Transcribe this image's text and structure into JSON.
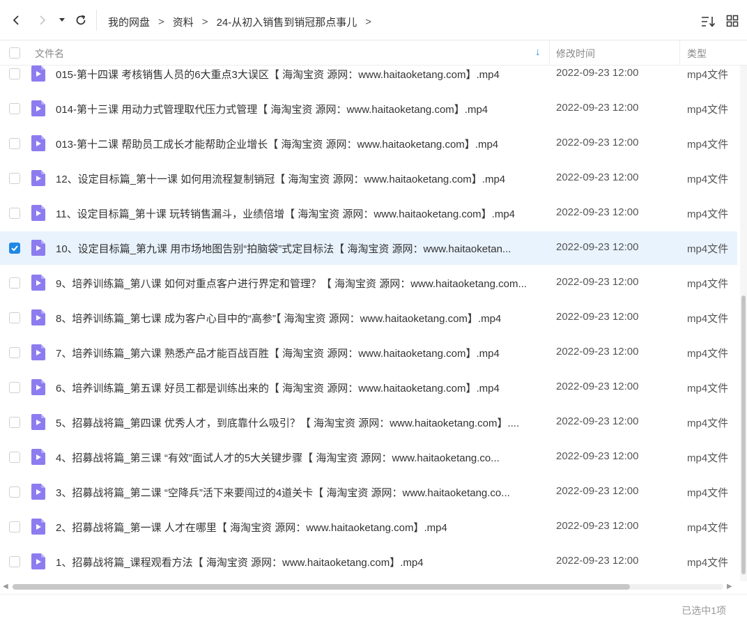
{
  "toolbar": {
    "back_icon": "chevron-left-icon",
    "forward_icon": "chevron-right-icon",
    "history_icon": "caret-down-icon",
    "refresh_icon": "refresh-icon",
    "breadcrumb": [
      "我的网盘",
      "资料",
      "24-从初入销售到销冠那点事儿"
    ],
    "crumb_sep": ">",
    "sort_icon": "sort-icon",
    "view_icon": "grid-view-icon"
  },
  "header": {
    "name": "文件名",
    "modified": "修改时间",
    "type": "类型",
    "sort_arrow": "↓"
  },
  "colors": {
    "accent": "#1e88e5",
    "selected_row": "#e9f3fd",
    "file_icon": "#8c7cf0"
  },
  "files": [
    {
      "name": "015-第十四课 考核销售人员的6大重点3大误区【 海淘宝资 源网：www.haitaoketang.com】.mp4",
      "date": "2022-09-23 12:00",
      "type": "mp4文件",
      "selected": false
    },
    {
      "name": "014-第十三课 用动力式管理取代压力式管理【 海淘宝资 源网：www.haitaoketang.com】.mp4",
      "date": "2022-09-23 12:00",
      "type": "mp4文件",
      "selected": false
    },
    {
      "name": "013-第十二课  帮助员工成长才能帮助企业增长【 海淘宝资 源网：www.haitaoketang.com】.mp4",
      "date": "2022-09-23 12:00",
      "type": "mp4文件",
      "selected": false
    },
    {
      "name": "12、设定目标篇_第十一课 如何用流程复制销冠【 海淘宝资 源网：www.haitaoketang.com】.mp4",
      "date": "2022-09-23 12:00",
      "type": "mp4文件",
      "selected": false
    },
    {
      "name": "11、设定目标篇_第十课 玩转销售漏斗，业绩倍增【 海淘宝资 源网：www.haitaoketang.com】.mp4",
      "date": "2022-09-23 12:00",
      "type": "mp4文件",
      "selected": false
    },
    {
      "name": "10、设定目标篇_第九课 用市场地图告别“拍脑袋”式定目标法【 海淘宝资 源网：www.haitaoketan...",
      "date": "2022-09-23 12:00",
      "type": "mp4文件",
      "selected": true
    },
    {
      "name": "9、培养训练篇_第八课 如何对重点客户进行界定和管理？【 海淘宝资 源网：www.haitaoketang.com...",
      "date": "2022-09-23 12:00",
      "type": "mp4文件",
      "selected": false
    },
    {
      "name": "8、培养训练篇_第七课  成为客户心目中的“高参”【 海淘宝资 源网：www.haitaoketang.com】.mp4",
      "date": "2022-09-23 12:00",
      "type": "mp4文件",
      "selected": false
    },
    {
      "name": "7、培养训练篇_第六课  熟悉产品才能百战百胜【 海淘宝资 源网：www.haitaoketang.com】.mp4",
      "date": "2022-09-23 12:00",
      "type": "mp4文件",
      "selected": false
    },
    {
      "name": "6、培养训练篇_第五课 好员工都是训练出来的【 海淘宝资 源网：www.haitaoketang.com】.mp4",
      "date": "2022-09-23 12:00",
      "type": "mp4文件",
      "selected": false
    },
    {
      "name": "5、招募战将篇_第四课 优秀人才，到底靠什么吸引？【 海淘宝资 源网：www.haitaoketang.com】....",
      "date": "2022-09-23 12:00",
      "type": "mp4文件",
      "selected": false
    },
    {
      "name": "4、招募战将篇_第三课    “有效”面试人才的5大关键步骤【 海淘宝资 源网：www.haitaoketang.co...",
      "date": "2022-09-23 12:00",
      "type": "mp4文件",
      "selected": false
    },
    {
      "name": "3、招募战将篇_第二课  “空降兵”活下来要闯过的4道关卡【 海淘宝资 源网：www.haitaoketang.co...",
      "date": "2022-09-23 12:00",
      "type": "mp4文件",
      "selected": false
    },
    {
      "name": "2、招募战将篇_第一课 人才在哪里【 海淘宝资 源网：www.haitaoketang.com】.mp4",
      "date": "2022-09-23 12:00",
      "type": "mp4文件",
      "selected": false
    },
    {
      "name": "1、招募战将篇_课程观看方法【 海淘宝资 源网：www.haitaoketang.com】.mp4",
      "date": "2022-09-23 12:00",
      "type": "mp4文件",
      "selected": false
    }
  ],
  "footer": {
    "status": "已选中1项"
  }
}
